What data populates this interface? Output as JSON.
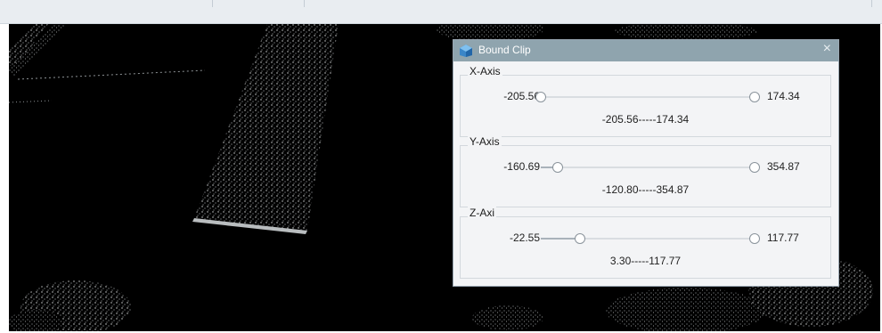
{
  "window": {
    "title": "Bound Clip",
    "close_symbol": "×"
  },
  "axes": [
    {
      "label": "X-Axis",
      "min": -205.56,
      "max": 174.34,
      "min_label": "-205.56",
      "max_label": "174.34",
      "low": -205.56,
      "high": 174.34,
      "range_text": "-205.56-----174.34"
    },
    {
      "label": "Y-Axis",
      "min": -160.69,
      "max": 354.87,
      "min_label": "-160.69",
      "max_label": "354.87",
      "low": -120.8,
      "high": 354.87,
      "range_text": "-120.80-----354.87"
    },
    {
      "label": "Z-Axi",
      "min": -22.55,
      "max": 117.77,
      "min_label": "-22.55",
      "max_label": "117.77",
      "low": 3.3,
      "high": 117.77,
      "range_text": "3.30-----117.77"
    }
  ],
  "colors": {
    "titlebar": "#8fa4ae",
    "viewport": "#000000",
    "pointcloud": "#cfd3d4"
  },
  "icons": {
    "app": "bound-clip-icon",
    "close": "close-icon"
  }
}
